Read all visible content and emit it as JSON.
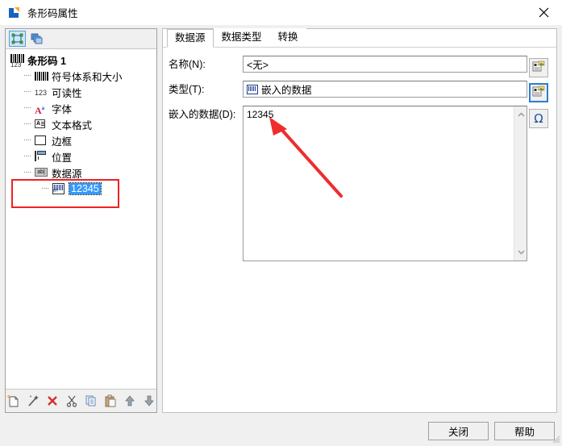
{
  "window": {
    "title": "条形码属性",
    "app_icon": "app-logo-icon",
    "close_label": "✕"
  },
  "left_panel": {
    "toolbar": [
      {
        "name": "objects-icon",
        "title": "对象",
        "selected": true
      },
      {
        "name": "layers-icon",
        "title": "图层",
        "selected": false
      }
    ],
    "tree": {
      "root": {
        "label": "条形码 1",
        "icon": "barcode-123-icon"
      },
      "items": [
        {
          "label": "符号体系和大小",
          "icon": "barcode-icon"
        },
        {
          "label": "可读性",
          "icon": "digits-123-icon"
        },
        {
          "label": "字体",
          "icon": "font-a-icon"
        },
        {
          "label": "文本格式",
          "icon": "text-format-icon"
        },
        {
          "label": "边框",
          "icon": "border-icon"
        },
        {
          "label": "位置",
          "icon": "position-ruler-icon"
        },
        {
          "label": "数据源",
          "icon": "ab-data-source-icon"
        }
      ],
      "selected_child": {
        "label": "12345",
        "icon": "embedded-data-icon"
      }
    },
    "bottom_toolbar": [
      {
        "name": "new-icon",
        "glyph": "🗋"
      },
      {
        "name": "wizard-icon",
        "glyph": "✨"
      },
      {
        "name": "delete-icon",
        "glyph": "✕"
      },
      {
        "name": "cut-icon",
        "glyph": "✂"
      },
      {
        "name": "copy-icon",
        "glyph": "⎘"
      },
      {
        "name": "paste-icon",
        "glyph": "📋"
      },
      {
        "name": "move-up-icon",
        "glyph": "⬆"
      },
      {
        "name": "move-down-icon",
        "glyph": "⬇"
      }
    ]
  },
  "right_panel": {
    "tabs": [
      {
        "label": "数据源",
        "active": true
      },
      {
        "label": "数据类型",
        "active": false
      },
      {
        "label": "转换",
        "active": false
      }
    ],
    "fields": {
      "name": {
        "label": "名称(N):",
        "value": "<无>",
        "placeholder": ""
      },
      "type": {
        "label": "类型(T):",
        "value": "嵌入的数据",
        "icon": "embedded-data-icon"
      },
      "embedded_data": {
        "label": "嵌入的数据(D):",
        "value": "12345",
        "placeholder": ""
      }
    },
    "side_buttons": [
      {
        "name": "name-browse-button",
        "icon": "properties-icon",
        "focused": false
      },
      {
        "name": "type-browse-button",
        "icon": "properties-icon",
        "focused": true
      },
      {
        "name": "insert-symbol-button",
        "icon": "omega-icon",
        "glyph": "Ω",
        "focused": false
      }
    ]
  },
  "footer": {
    "close_label": "关闭",
    "help_label": "帮助"
  },
  "annotations": {
    "rect_color": "#ee2222",
    "arrow_color": "#ee2d2d",
    "rect_target": "tree-selected-node",
    "arrow_target": "embedded-data-textarea-value"
  },
  "colors": {
    "accent": "#3399ff",
    "dialog_bg": "#f0f0f0",
    "panel_bg": "#ffffff",
    "annotation": "#ee2222"
  }
}
